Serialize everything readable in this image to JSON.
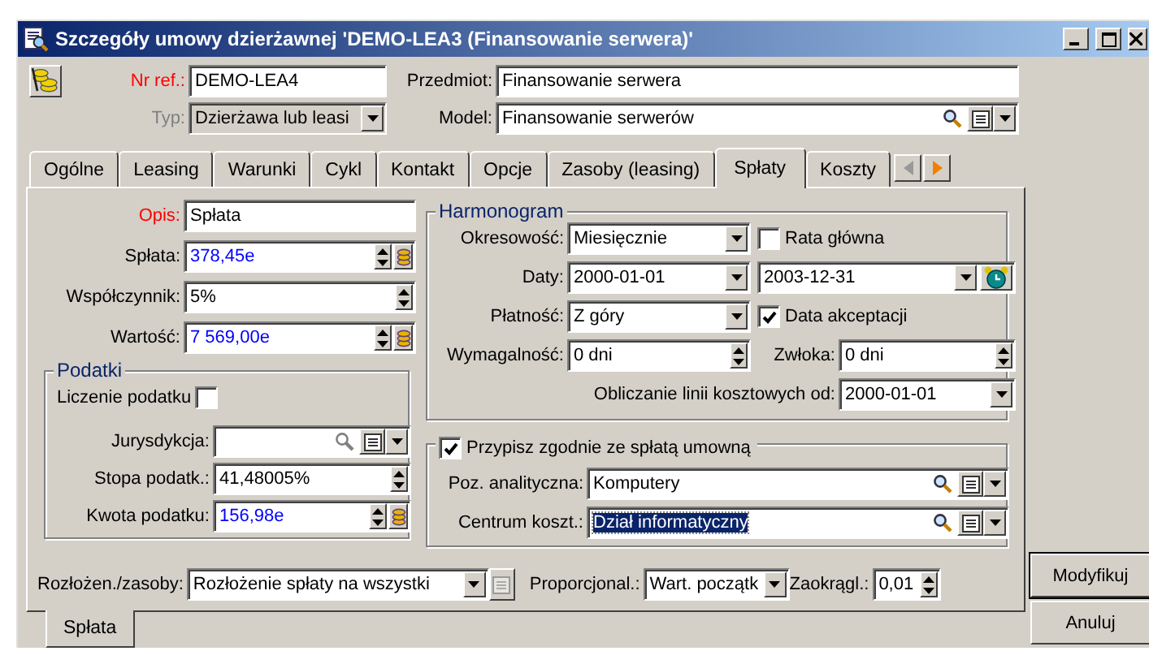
{
  "window": {
    "title": "Szczegóły umowy dzierżawnej 'DEMO-LEA3 (Finansowanie serwera)'"
  },
  "header": {
    "ref": {
      "label": "Nr ref.:",
      "required": true,
      "disabled": false,
      "value": "DEMO-LEA4",
      "kind": "text"
    },
    "type": {
      "label": "Typ:",
      "disabled": true,
      "value": "Dzierżawa lub leasi",
      "kind": "combo"
    },
    "subject": {
      "label": "Przedmiot:",
      "required": false,
      "disabled": false,
      "value": "Finansowanie serwera",
      "kind": "text"
    },
    "model": {
      "label": "Model:",
      "required": false,
      "disabled": false,
      "value": "Finansowanie serwerów",
      "kind": "lookup"
    }
  },
  "tabs": [
    {
      "label": "Ogólne",
      "selected": false
    },
    {
      "label": "Leasing",
      "selected": false
    },
    {
      "label": "Warunki",
      "selected": false
    },
    {
      "label": "Cykl",
      "selected": false
    },
    {
      "label": "Kontakt",
      "selected": false
    },
    {
      "label": "Opcje",
      "selected": false
    },
    {
      "label": "Zasoby (leasing)",
      "selected": false
    },
    {
      "label": "Spłaty",
      "selected": true
    },
    {
      "label": "Koszty",
      "selected": false
    }
  ],
  "payment": {
    "fields": [
      {
        "label": "Opis:",
        "required": true,
        "value": "Spłata",
        "kind": "text"
      },
      {
        "label": "Spłata:",
        "required": false,
        "value": "378,45e",
        "kind": "money"
      },
      {
        "label": "Współczynnik:",
        "required": false,
        "value": "5%",
        "kind": "spin"
      },
      {
        "label": "Wartość:",
        "required": false,
        "value": "7 569,00e",
        "kind": "money"
      }
    ]
  },
  "taxes": {
    "title": "Podatki",
    "calc": {
      "label": "Liczenie podatku",
      "checked": false
    },
    "fields": [
      {
        "label": "Jurysdykcja:",
        "required": false,
        "kind": "lookup"
      },
      {
        "label": "Stopa podatk.:",
        "required": false,
        "value": "41,48005%",
        "kind": "spin"
      },
      {
        "label": "Kwota podatku:",
        "required": false,
        "value": "156,98e",
        "kind": "money"
      }
    ]
  },
  "schedule": {
    "title": "Harmonogram",
    "periodicity": {
      "label": "Okresowość:",
      "value": "Miesięcznie",
      "kind": "combo"
    },
    "main_installment": {
      "label": "Rata główna",
      "checked": false
    },
    "dates_label": "Daty:",
    "start": {
      "value": "2000-01-01",
      "kind": "combo"
    },
    "end": {
      "value": "2003-12-31",
      "kind": "date-alarm"
    },
    "payment": {
      "label": "Płatność:",
      "value": "Z góry",
      "kind": "combo"
    },
    "acceptance": {
      "label": "Data akceptacji",
      "checked": true
    },
    "due": {
      "label": "Wymagalność:",
      "value": "0 dni",
      "kind": "spin"
    },
    "delay": {
      "label": "Zwłoka:",
      "value": "0 dni",
      "kind": "spin"
    },
    "cost_lines": {
      "label": "Obliczanie linii kosztowych od:",
      "value": "2000-01-01",
      "kind": "combo"
    }
  },
  "allocation": {
    "label": "Przypisz zgodnie ze spłatą umowną",
    "checked": true,
    "fields": [
      {
        "label": "Poz. analityczna:",
        "value": "Komputery",
        "kind": "lookup",
        "selected": false
      },
      {
        "label": "Centrum koszt.:",
        "value": "Dział informatyczny",
        "kind": "lookup",
        "selected": true
      }
    ]
  },
  "footer": {
    "distribution": {
      "label": "Rozłożen./zasoby:",
      "value": "Rozłożenie spłaty na wszystki",
      "kind": "combo"
    },
    "proportional": {
      "label": "Proporcjonal.:",
      "value": "Wart. początk",
      "kind": "combo"
    },
    "rounding": {
      "label": "Zaokrągl.:",
      "value": "0,01",
      "kind": "spin"
    }
  },
  "bottom_tabs": [
    {
      "label": "Spłata",
      "selected": true
    }
  ],
  "buttons": [
    {
      "label": "Modyfikuj",
      "default": true
    },
    {
      "label": "Anuluj",
      "default": false
    }
  ]
}
